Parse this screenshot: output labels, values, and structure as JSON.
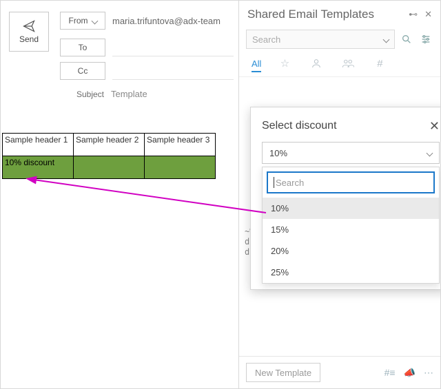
{
  "compose": {
    "send_label": "Send",
    "from_label": "From",
    "from_value": "maria.trifuntova@adx-team",
    "to_label": "To",
    "cc_label": "Cc",
    "subject_label": "Subject",
    "subject_value": "Template"
  },
  "table": {
    "headers": [
      "Sample header 1",
      "Sample header 2",
      "Sample header 3"
    ],
    "row_green": [
      "10% discount",
      "",
      ""
    ]
  },
  "panel": {
    "title": "Shared Email Templates",
    "search_placeholder": "Search",
    "tabs": {
      "all": "All"
    },
    "new_template": "New Template",
    "snippet": "~%\ndi\ndi"
  },
  "popup": {
    "title": "Select discount",
    "selected": "10%",
    "search_placeholder": "Search",
    "options": [
      "10%",
      "15%",
      "20%",
      "25%"
    ]
  }
}
